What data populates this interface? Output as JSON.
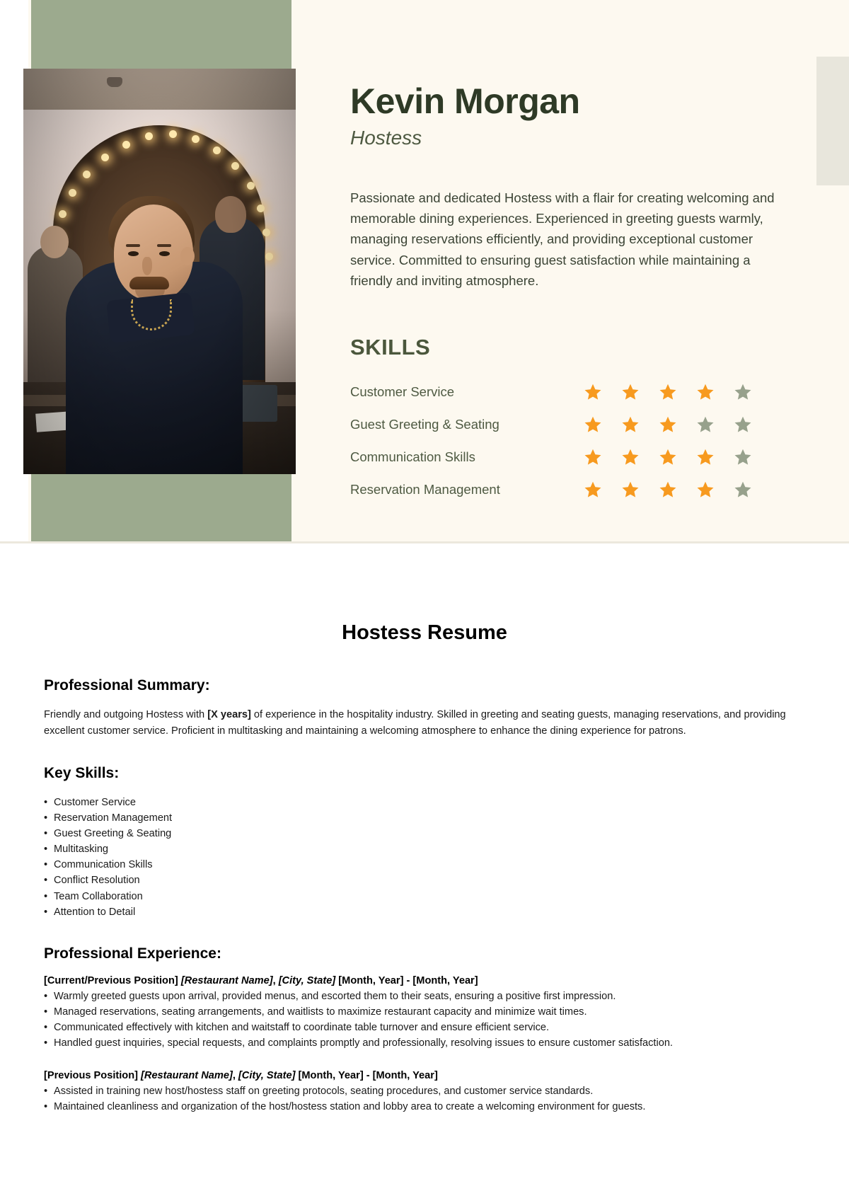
{
  "colors": {
    "sage": "#9caa8e",
    "cream": "#fdf9f0",
    "dark_green": "#2e3a26",
    "star_filled": "#f79a1f",
    "star_empty": "#97a18c"
  },
  "resume_card": {
    "photo_alt": "portrait-photo",
    "name": "Kevin Morgan",
    "role": "Hostess",
    "summary": "Passionate and dedicated Hostess with a flair for creating welcoming and memorable dining experiences. Experienced in greeting guests warmly, managing reservations efficiently, and providing exceptional customer service. Committed to ensuring guest satisfaction while maintaining a friendly and inviting atmosphere.",
    "skills_heading": "SKILLS",
    "max_rating": 5,
    "skills": [
      {
        "label": "Customer Service",
        "rating": 4
      },
      {
        "label": "Guest Greeting & Seating",
        "rating": 3
      },
      {
        "label": "Communication Skills",
        "rating": 4
      },
      {
        "label": "Reservation Management",
        "rating": 4
      }
    ]
  },
  "document": {
    "title": "Hostess Resume",
    "summary_heading": "Professional Summary:",
    "summary_parts": {
      "before": "Friendly and outgoing Hostess with ",
      "bold": "[X years]",
      "after": " of experience in the hospitality industry. Skilled in greeting and seating guests, managing reservations, and providing excellent customer service. Proficient in multitasking and maintaining a welcoming atmosphere to enhance the dining experience for patrons."
    },
    "key_skills_heading": "Key Skills:",
    "key_skills": [
      "Customer Service",
      "Reservation Management",
      "Guest Greeting & Seating",
      "Multitasking",
      "Communication Skills",
      "Conflict Resolution",
      "Team Collaboration",
      "Attention to Detail"
    ],
    "experience_heading": "Professional Experience:",
    "jobs": [
      {
        "position": "[Current/Previous Position]",
        "restaurant": "[Restaurant Name]",
        "location": "[City, State]",
        "dates": "[Month, Year] - [Month, Year]",
        "bullets": [
          "Warmly greeted guests upon arrival, provided menus, and escorted them to their seats, ensuring a positive first impression.",
          "Managed reservations, seating arrangements, and waitlists to maximize restaurant capacity and minimize wait times.",
          "Communicated effectively with kitchen and waitstaff to coordinate table turnover and ensure efficient service.",
          "Handled guest inquiries, special requests, and complaints promptly and professionally, resolving issues to ensure customer satisfaction."
        ]
      },
      {
        "position": "[Previous Position]",
        "restaurant": "[Restaurant Name]",
        "location": "[City, State]",
        "dates": "[Month, Year] - [Month, Year]",
        "bullets": [
          "Assisted in training new host/hostess staff on greeting protocols, seating procedures, and customer service standards.",
          "Maintained cleanliness and organization of the host/hostess station and lobby area to create a welcoming environment for guests."
        ]
      }
    ]
  }
}
